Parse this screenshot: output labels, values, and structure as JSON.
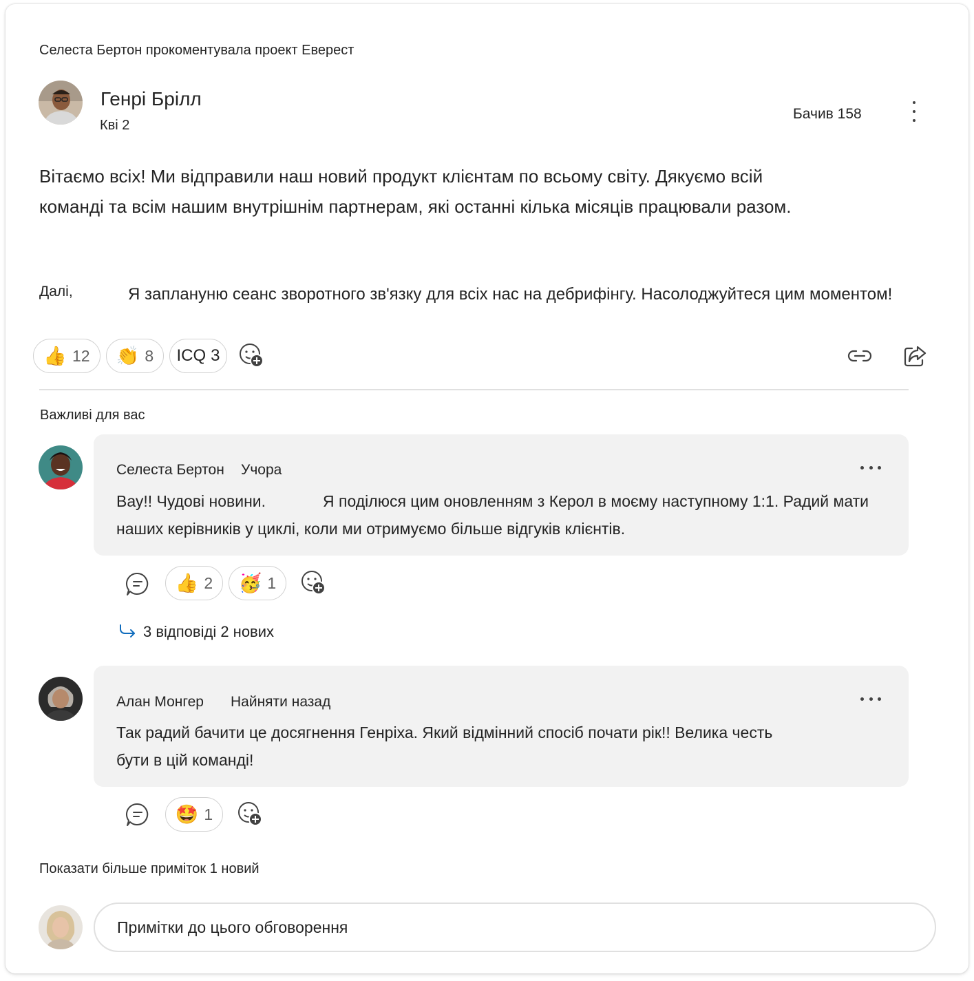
{
  "context_line": "Селеста Бертон прокоментувала проект Еверест",
  "post": {
    "author": "Генрі Брілл",
    "date": "Кві 2",
    "views": "Бачив 158",
    "body_paragraph": "Вітаємо всіх! Ми відправили наш новий продукт клієнтам по всьому світу. Дякуємо всій команді та всім нашим внутрішнім партнерам, які останні кілька місяців працювали разом.",
    "body_next_label": "Далі,",
    "body_next_text": "Я заплануню сеанс зворотного зв'язку для всіх нас на дебрифінгу. Насолоджуйтеся цим моментом!",
    "reactions": [
      {
        "emoji": "👍",
        "icon": "thumbs-up-icon",
        "count": "12"
      },
      {
        "emoji": "👏",
        "icon": "clapping-hands-icon",
        "count": "8"
      },
      {
        "emoji": "",
        "icon": "icq-reaction",
        "label": "ICQ",
        "count": "3"
      }
    ]
  },
  "section_label": "Важливі для вас",
  "comments": [
    {
      "name": "Селеста Бертон",
      "time": "Учора",
      "text_part1": "Вау!! Чудові новини.",
      "text_part2": "Я поділюся цим оновленням з Керол в моєму наступному 1:1. Радий мати",
      "text_line2": "наших керівників у циклі, коли ми отримуємо більше відгуків клієнтів.",
      "reactions": [
        {
          "emoji": "👍",
          "icon": "thumbs-up-icon",
          "count": "2"
        },
        {
          "emoji": "🥳",
          "icon": "party-face-icon",
          "count": "1"
        }
      ],
      "replies": "3 відповіді 2 нових"
    },
    {
      "name": "Алан Монгер",
      "time": "Найняти назад",
      "text_line1": "Так радий бачити це досягнення Генріха. Який відмінний спосіб почати рік!! Велика честь",
      "text_line2": "бути в цій команді!",
      "reactions": [
        {
          "emoji": "🤩",
          "icon": "star-struck-icon",
          "count": "1"
        }
      ]
    }
  ],
  "show_more": "Показати більше приміток 1 новий",
  "compose_placeholder": "Примітки до цього обговорення",
  "colors": {
    "link_arrow": "#0f6cbd",
    "bubble": "#f2f2f2",
    "border": "#d1d1d1"
  }
}
